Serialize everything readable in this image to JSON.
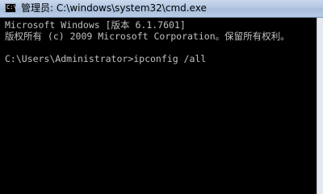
{
  "window": {
    "title": "管理员: C:\\windows\\system32\\cmd.exe",
    "icon_name": "cmd-icon",
    "icon_glyph": "C:\\"
  },
  "console": {
    "lines": [
      "Microsoft Windows [版本 6.1.7601]",
      "版权所有 (c) 2009 Microsoft Corporation。保留所有权利。",
      "",
      "C:\\Users\\Administrator>ipconfig /all"
    ]
  },
  "colors": {
    "console_background": "#000000",
    "console_text": "#c0c0c0",
    "titlebar": "#b3c7e2"
  }
}
